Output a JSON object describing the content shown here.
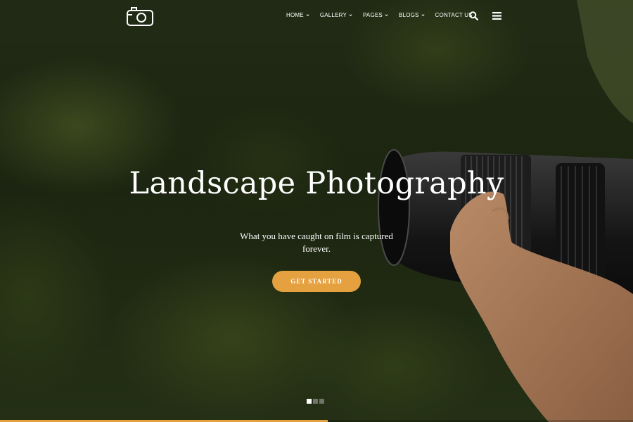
{
  "brand": {
    "logo_icon": "camera-icon",
    "accent_color": "#e5a03f"
  },
  "nav": {
    "items": [
      {
        "label": "HOME",
        "has_dropdown": true
      },
      {
        "label": "GALLERY",
        "has_dropdown": true
      },
      {
        "label": "PAGES",
        "has_dropdown": true
      },
      {
        "label": "BLOGS",
        "has_dropdown": true
      },
      {
        "label": "CONTACT US",
        "has_dropdown": false
      }
    ],
    "search_icon": "search-icon",
    "menu_icon": "hamburger-menu-icon"
  },
  "hero": {
    "title": "Landscape Photography",
    "subtitle": "What you have caught on film is captured forever.",
    "cta_label": "GET STARTED"
  },
  "slider": {
    "slide_count": 3,
    "active_index": 0,
    "progress": 0.518
  }
}
